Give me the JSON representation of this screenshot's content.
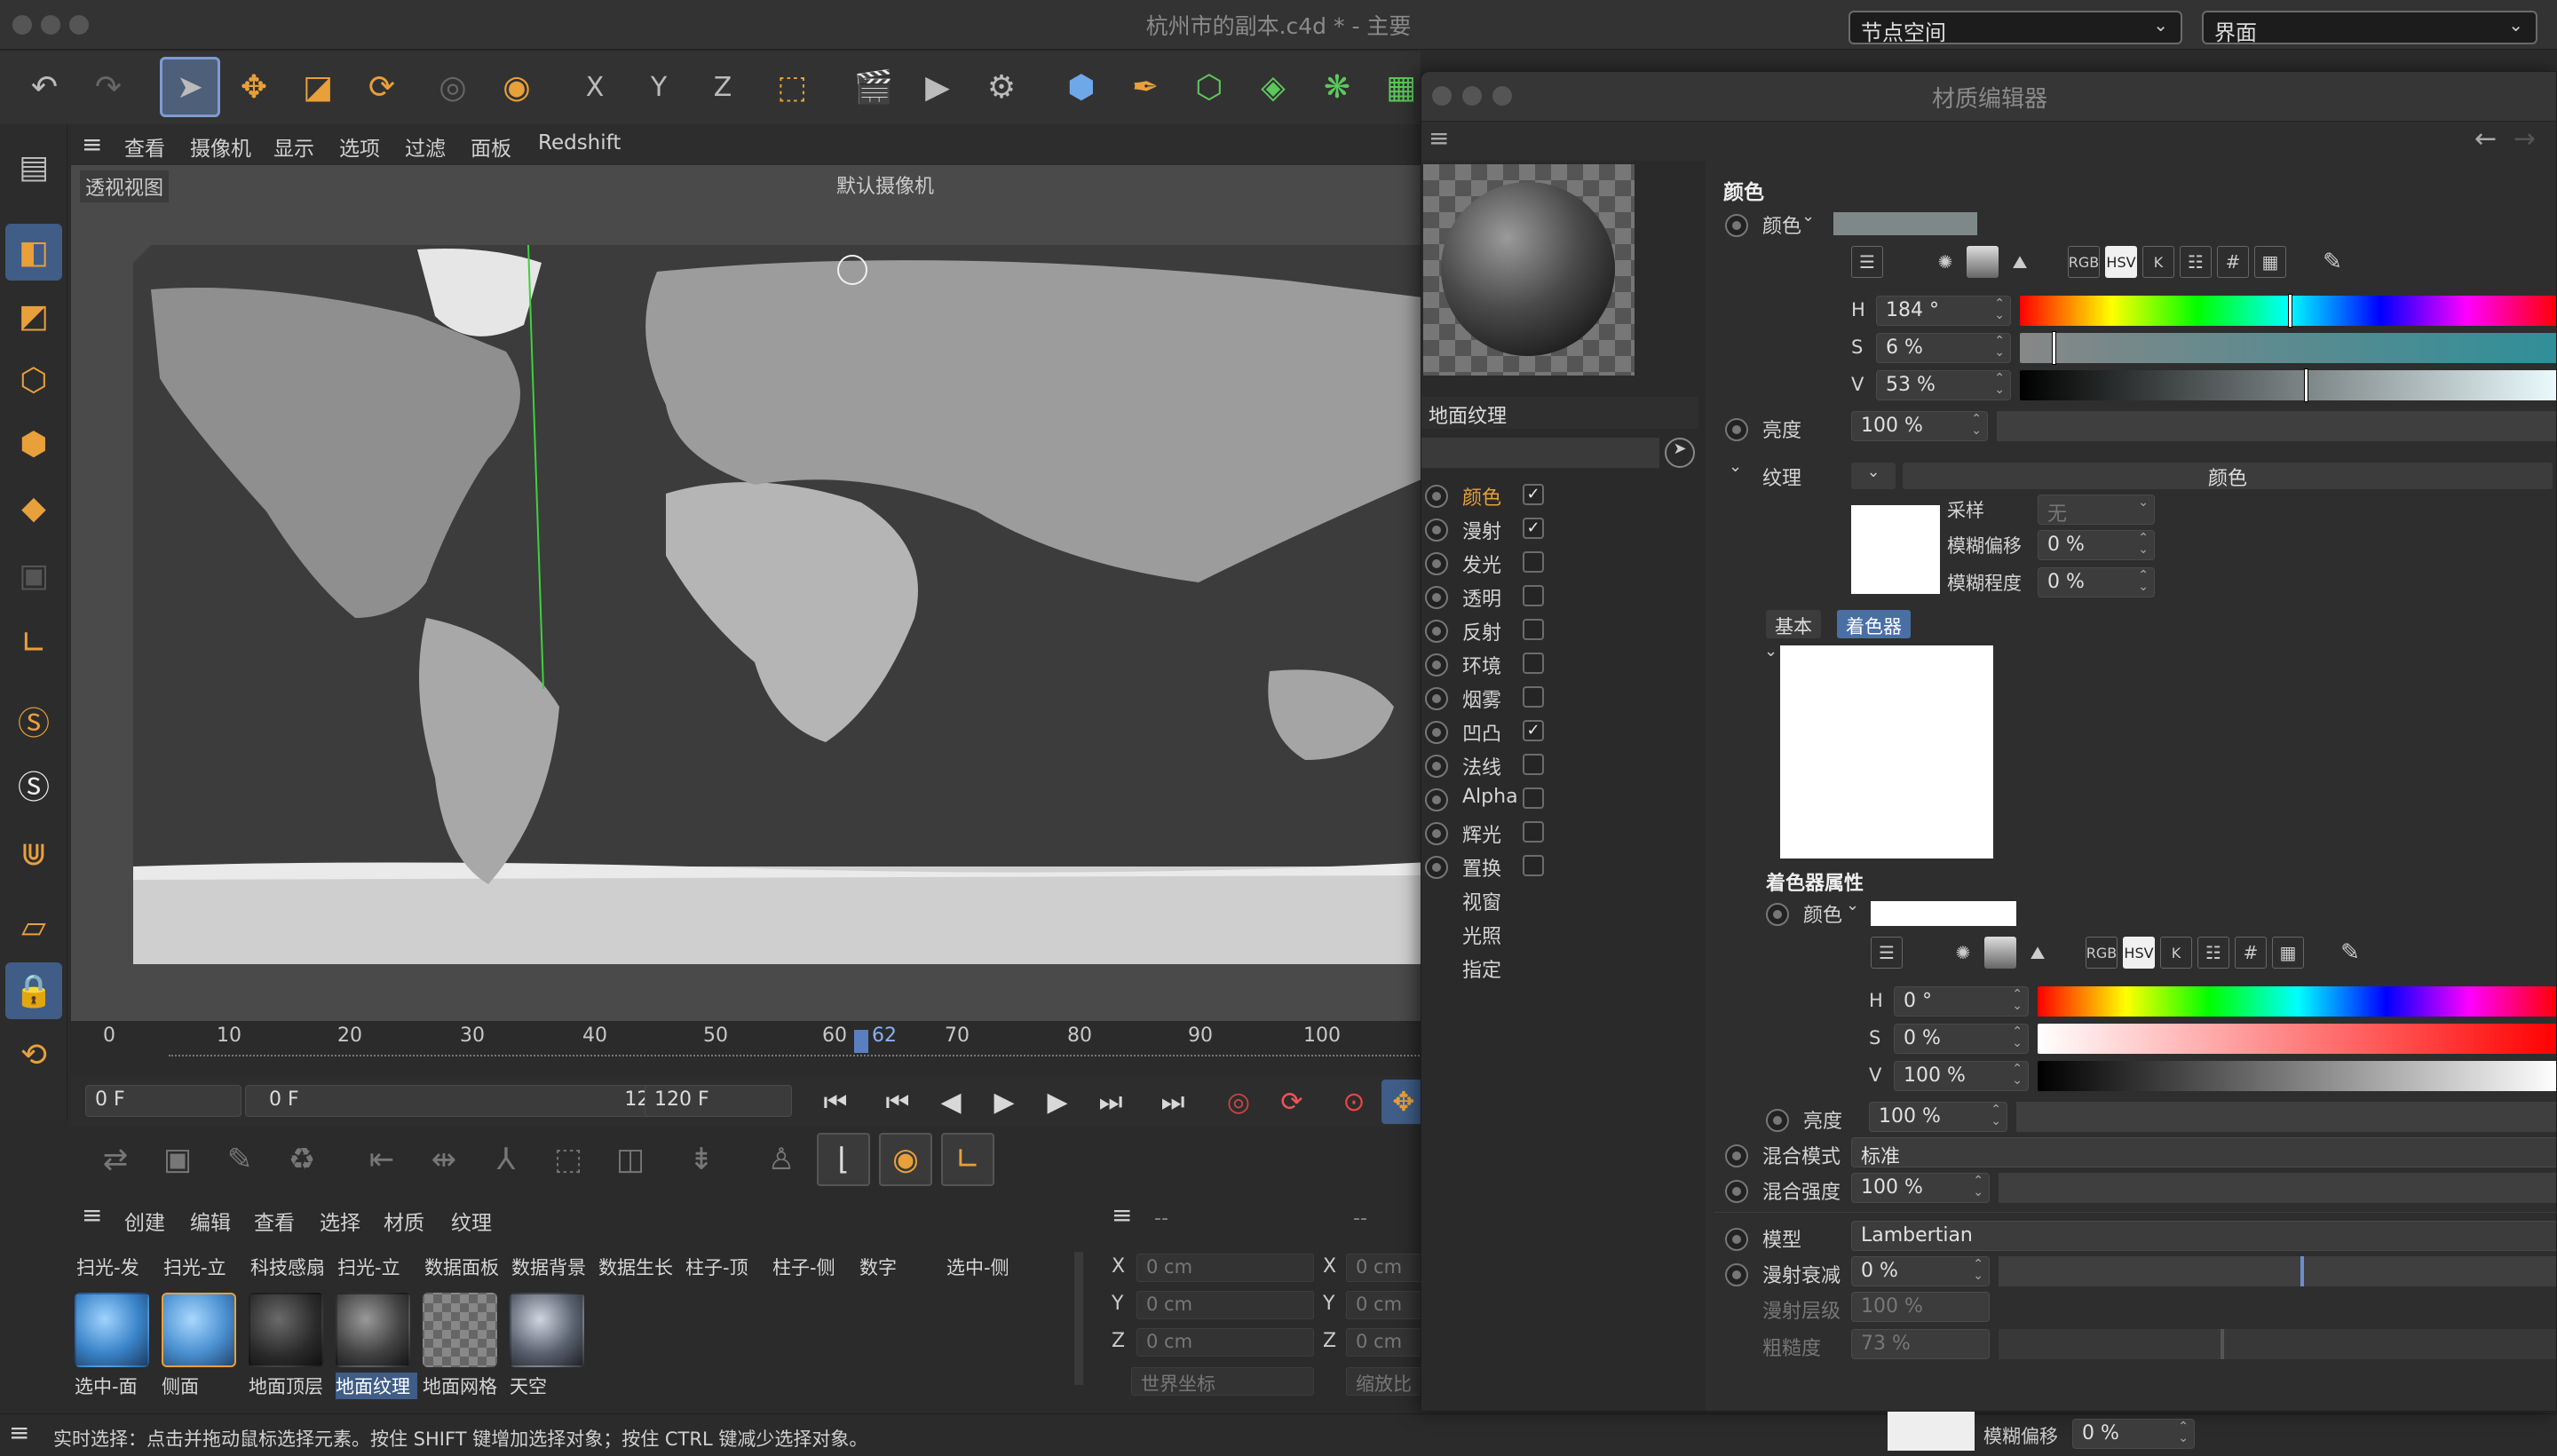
{
  "window": {
    "title": "杭州市的副本.c4d * - 主要"
  },
  "top_dropdowns": [
    {
      "value": "节点空间"
    },
    {
      "value": "界面"
    }
  ],
  "toolbar": {
    "icons": [
      "undo-icon",
      "redo-icon",
      "select-cursor-icon",
      "move-icon",
      "scale-icon",
      "rotate-icon",
      "object-icon",
      "live-select-icon",
      "x-axis-icon",
      "y-axis-icon",
      "z-axis-icon",
      "coordinate-system-icon",
      "render-region-icon",
      "render-view-icon",
      "render-settings-icon",
      "cube-icon",
      "pen-icon",
      "subdivision-icon",
      "extrude-icon",
      "cloner-icon",
      "generators-icon"
    ],
    "x_label": "X",
    "y_label": "Y",
    "z_label": "Z"
  },
  "viewport_menu": [
    "查看",
    "摄像机",
    "显示",
    "选项",
    "过滤",
    "面板",
    "Redshift"
  ],
  "viewport": {
    "name": "透视视图",
    "camera": "默认摄像机"
  },
  "timeline": {
    "ticks": [
      "0",
      "10",
      "20",
      "30",
      "40",
      "50",
      "60",
      "70",
      "80",
      "90",
      "100"
    ],
    "current": "62"
  },
  "transport": {
    "start": "0 F",
    "range_start": "0 F",
    "range_end": "120 F",
    "end": "120 F"
  },
  "material_menu": [
    "创建",
    "编辑",
    "查看",
    "选择",
    "材质",
    "纹理"
  ],
  "material_row1": [
    "扫光-发",
    "扫光-立",
    "科技感扇",
    "扫光-立",
    "数据面板",
    "数据背景",
    "数据生长",
    "柱子-顶",
    "柱子-侧",
    "数字",
    "选中-侧"
  ],
  "material_row2": [
    {
      "label": "选中-面",
      "style": "blue-sphere"
    },
    {
      "label": "侧面",
      "style": "blue-sphere",
      "selected": true
    },
    {
      "label": "地面顶层",
      "style": "dark-sphere"
    },
    {
      "label": "地面纹理",
      "style": "earth-sphere",
      "active": true
    },
    {
      "label": "地面网格",
      "style": "checker"
    },
    {
      "label": "天空",
      "style": "sky-sphere"
    }
  ],
  "coords": {
    "header1": "--",
    "header2": "--",
    "rows": [
      {
        "axis": "X",
        "v1": "0 cm",
        "v2": "0 cm"
      },
      {
        "axis": "Y",
        "v1": "0 cm",
        "v2": "0 cm"
      },
      {
        "axis": "Z",
        "v1": "0 cm",
        "v2": "0 cm"
      }
    ],
    "space": "世界坐标",
    "scale": "缩放比"
  },
  "status": "实时选择：点击并拖动鼠标选择元素。按住 SHIFT 键增加选择对象；按住 CTRL 键减少选择对象。",
  "editor": {
    "title": "材质编辑器",
    "material_name": "地面纹理",
    "channels": [
      {
        "name": "颜色",
        "checked": true,
        "active": true
      },
      {
        "name": "漫射",
        "checked": true
      },
      {
        "name": "发光",
        "checked": false
      },
      {
        "name": "透明",
        "checked": false
      },
      {
        "name": "反射",
        "checked": false
      },
      {
        "name": "环境",
        "checked": false
      },
      {
        "name": "烟雾",
        "checked": false
      },
      {
        "name": "凹凸",
        "checked": true
      },
      {
        "name": "法线",
        "checked": false
      },
      {
        "name": "Alpha",
        "checked": false
      },
      {
        "name": "辉光",
        "checked": false
      },
      {
        "name": "置换",
        "checked": false
      }
    ],
    "extra": [
      "视窗",
      "光照",
      "指定"
    ],
    "section": "颜色",
    "color_label": "颜色",
    "color_swatch": "#7f8889",
    "mode_buttons": [
      "RGB",
      "HSV",
      "K"
    ],
    "h": {
      "label": "H",
      "value": "184 °",
      "level": 0.51
    },
    "s": {
      "label": "S",
      "value": "6 %",
      "level": 0.06
    },
    "v": {
      "label": "V",
      "value": "53 %",
      "level": 0.53
    },
    "brightness": {
      "label": "亮度",
      "value": "100 %"
    },
    "texture": {
      "label": "纹理",
      "name": "颜色",
      "sampling_label": "采样",
      "sampling_value": "无",
      "blur_offset_label": "模糊偏移",
      "blur_offset": "0 %",
      "blur_amount_label": "模糊程度",
      "blur_amount": "0 %"
    },
    "tabs": [
      "基本",
      "着色器"
    ],
    "shader_props": "着色器属性",
    "shader_color_label": "颜色",
    "sh_h": {
      "label": "H",
      "value": "0 °"
    },
    "sh_s": {
      "label": "S",
      "value": "0 %"
    },
    "sh_v": {
      "label": "V",
      "value": "100 %"
    },
    "sh_brightness": {
      "label": "亮度",
      "value": "100 %"
    },
    "blend_mode_label": "混合模式",
    "blend_mode": "标准",
    "blend_strength_label": "混合强度",
    "blend_strength": "100 %",
    "model_label": "模型",
    "model": "Lambertian",
    "diffuse_falloff_label": "漫射衰减",
    "diffuse_falloff": "0 %",
    "diffuse_level_label": "漫射层级",
    "diffuse_level": "100 %",
    "roughness_label": "粗糙度",
    "roughness": "73 %",
    "bottom_blur_label": "模糊偏移",
    "bottom_blur": "0 %"
  },
  "colors": {
    "accent": "#e8a03a",
    "selection": "#4a6fa5"
  }
}
